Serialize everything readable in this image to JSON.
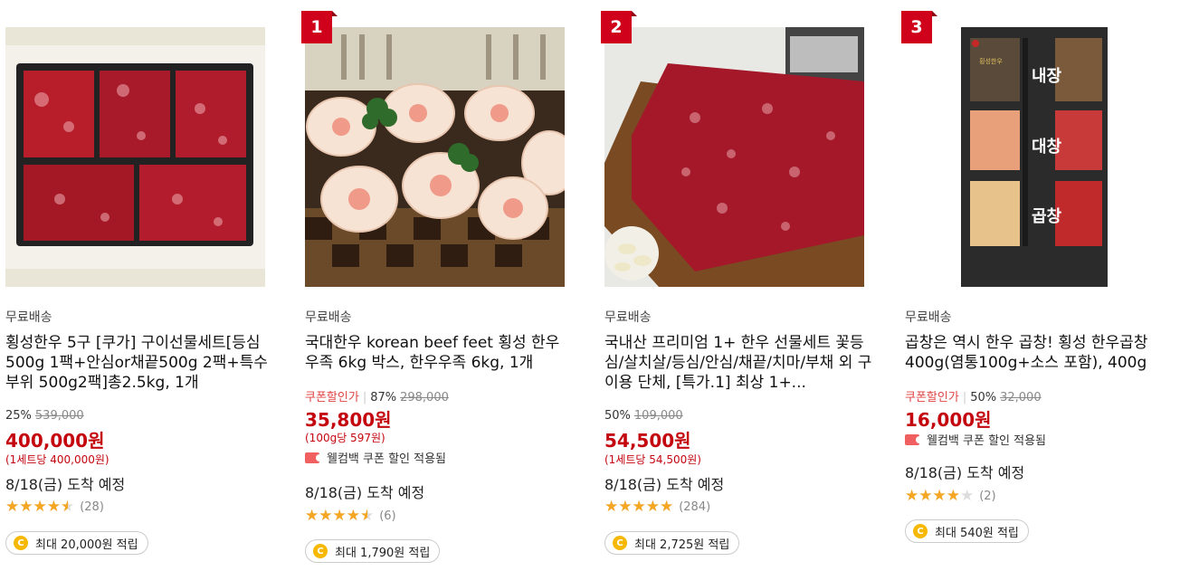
{
  "products": [
    {
      "rank": "",
      "shipping": "무료배송",
      "title": "횡성한우 5구 [쿠가] 구이선물세트[등심500g 1팩+안심or채끝500g 2팩+특수부위 500g2팩]총2.5kg, 1개",
      "coupon_label": "",
      "discount": "25%",
      "original_price": "539,000",
      "price": "400,000원",
      "unit_price": "(1세트당 400,000원)",
      "welcome_coupon": "",
      "delivery": "8/18(금) 도착 예정",
      "rating": 4.5,
      "review_count": "(28)",
      "reward": "최대 20,000원 적립"
    },
    {
      "rank": "1",
      "shipping": "무료배송",
      "title": "국대한우 korean beef feet 횡성 한우 우족 6kg 박스, 한우우족 6kg, 1개",
      "coupon_label": "쿠폰할인가",
      "discount": "87%",
      "original_price": "298,000",
      "price": "35,800원",
      "unit_price": "(100g당 597원)",
      "welcome_coupon": "웰컴백 쿠폰 할인 적용됨",
      "delivery": "8/18(금) 도착 예정",
      "rating": 4.5,
      "review_count": "(6)",
      "reward": "최대 1,790원 적립"
    },
    {
      "rank": "2",
      "shipping": "무료배송",
      "title": "국내산 프리미엄 1+ 한우 선물세트 꽃등심/살치살/등심/안심/채끝/치마/부채 외 구이용 단체, [특가.1] 최상 1+...",
      "coupon_label": "",
      "discount": "50%",
      "original_price": "109,000",
      "price": "54,500원",
      "unit_price": "(1세트당 54,500원)",
      "welcome_coupon": "",
      "delivery": "8/18(금) 도착 예정",
      "rating": 5,
      "review_count": "(284)",
      "reward": "최대 2,725원 적립"
    },
    {
      "rank": "3",
      "shipping": "무료배송",
      "title": "곱창은 역시 한우 곱창! 횡성 한우곱창 400g(염통100g+소스 포함), 400g",
      "coupon_label": "쿠폰할인가",
      "discount": "50%",
      "original_price": "32,000",
      "price": "16,000원",
      "unit_price": "",
      "welcome_coupon": "웰컴백 쿠폰 할인 적용됨",
      "delivery": "8/18(금) 도착 예정",
      "rating": 4,
      "review_count": "(2)",
      "reward": "최대 540원 적립"
    }
  ],
  "image_labels": {
    "p4_box1": "내장",
    "p4_box2": "대창",
    "p4_box3": "곱창",
    "p4_subtext": "횡성한우"
  },
  "colors": {
    "price_red": "#c4060f",
    "rank_red": "#d0021b",
    "star": "#f5a623",
    "coin": "#f6b800"
  }
}
